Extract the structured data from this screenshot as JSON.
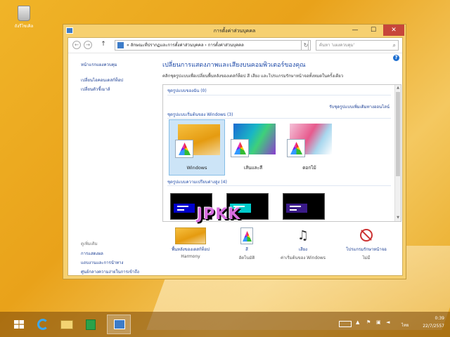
{
  "desktop": {
    "recycle_bin_label": "ถังรีไซเคิล"
  },
  "window": {
    "title": "การตั้งค่าส่วนบุคคล",
    "controls": {
      "minimize": "—",
      "maximize": "☐",
      "close": "✕"
    }
  },
  "address": {
    "back": "←",
    "forward": "→",
    "up": "↑",
    "path": "«  ลักษณะที่ปรากฏและการตั้งค่าส่วนบุคคล  ›  การตั้งค่าส่วนบุคคล",
    "refresh": "↻",
    "search_placeholder": "ค้นหา 'แผงควบคุม'"
  },
  "help": "?",
  "sidebar": {
    "home": "หน้าแรกแผงควบคุม",
    "items": [
      "เปลี่ยนไอคอนเดสก์ท็อป",
      "เปลี่ยนตัวชี้เมาส์"
    ],
    "see_also_label": "ดูเพิ่มเติม",
    "see_also": [
      "การแสดงผล",
      "แถบงานและการนำทาง",
      "ศูนย์กลางความง่ายในการเข้าถึง"
    ]
  },
  "main": {
    "heading": "เปลี่ยนการแสดงภาพและเสียงบนคอมพิวเตอร์ของคุณ",
    "description": "คลิกชุดรูปแบบเพื่อเปลี่ยนพื้นหลังของเดสก์ท็อป สี เสียง และโปรแกรมรักษาหน้าจอทั้งหมดในครั้งเดียว",
    "sections": {
      "my_themes": "ชุดรูปแบบของฉัน (0)",
      "get_online": "รับชุดรูปแบบเพิ่มเติมทางออนไลน์",
      "default_themes": "ชุดรูปแบบเริ่มต้นของ Windows (3)",
      "high_contrast": "ชุดรูปแบบความเปรียบต่างสูง (4)"
    },
    "themes": [
      {
        "name": "Windows"
      },
      {
        "name": "เส้นและสี"
      },
      {
        "name": "ดอกไม้"
      }
    ],
    "high_contrast_colors": [
      "#0000cc",
      "#00cccc",
      "#3a1a88"
    ]
  },
  "bottom": {
    "background": {
      "label": "พื้นหลังของเดสก์ท็อป",
      "value": "Harmony"
    },
    "color": {
      "label": "สี",
      "value": "อัตโนมัติ"
    },
    "sounds": {
      "label": "เสียง",
      "value": "ค่าเริ่มต้นของ Windows"
    },
    "screensaver": {
      "label": "โปรแกรมรักษาหน้าจอ",
      "value": "ไม่มี"
    }
  },
  "watermark": "JPKK",
  "taskbar": {
    "tray": {
      "time": "0:39",
      "date": "22/7/2557",
      "language": "ไทย"
    }
  }
}
